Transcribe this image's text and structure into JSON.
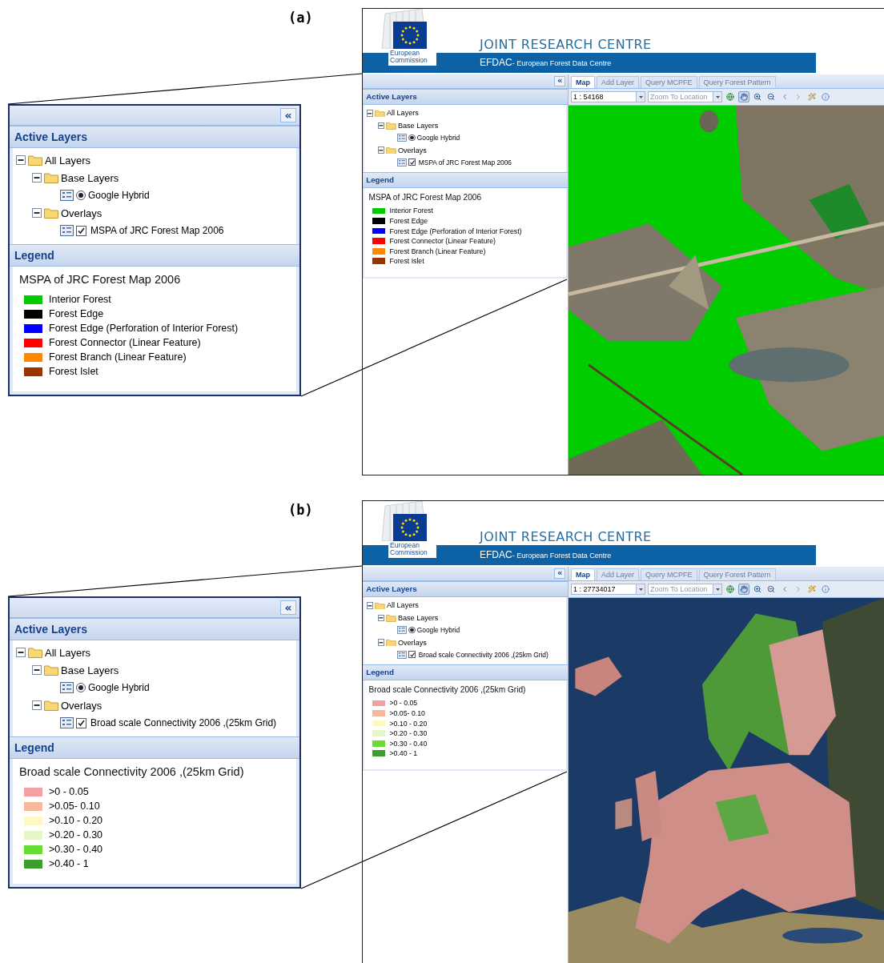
{
  "panels": [
    {
      "label": "(a)",
      "callout": {
        "collapse": "«",
        "layers_title": "Active Layers",
        "tree": [
          {
            "label": "All Layers",
            "kind": "folder",
            "expanded": true,
            "children": [
              {
                "label": "Base Layers",
                "kind": "folder",
                "expanded": true,
                "children": [
                  {
                    "label": "Google Hybrid",
                    "kind": "radio",
                    "selected": true
                  }
                ]
              },
              {
                "label": "Overlays",
                "kind": "folder",
                "expanded": true,
                "children": [
                  {
                    "label": "MSPA of JRC Forest Map 2006",
                    "kind": "checkbox",
                    "checked": true
                  }
                ]
              }
            ]
          }
        ],
        "legend_title": "Legend",
        "legend": {
          "title": "MSPA of JRC Forest Map 2006",
          "items": [
            {
              "label": "Interior Forest",
              "color": "#00cc00"
            },
            {
              "label": "Forest Edge",
              "color": "#000000"
            },
            {
              "label": "Forest Edge (Perforation of Interior Forest)",
              "color": "#0000ff"
            },
            {
              "label": "Forest Connector (Linear Feature)",
              "color": "#ff0000"
            },
            {
              "label": "Forest Branch (Linear Feature)",
              "color": "#ff8800"
            },
            {
              "label": "Forest Islet",
              "color": "#993300"
            }
          ]
        }
      },
      "app": {
        "header": {
          "logo_caption": "European Commission",
          "title": "JOINT RESEARCH CENTRE",
          "subtitle_lead": "EFDAC",
          "subtitle": "- European Forest Data Centre"
        },
        "sidebar": {
          "collapse": "«",
          "layers_title": "Active Layers",
          "tree": [
            {
              "label": "All Layers",
              "kind": "folder",
              "expanded": true,
              "children": [
                {
                  "label": "Base Layers",
                  "kind": "folder",
                  "expanded": true,
                  "children": [
                    {
                      "label": "Google Hybrid",
                      "kind": "radio",
                      "selected": true
                    }
                  ]
                },
                {
                  "label": "Overlays",
                  "kind": "folder",
                  "expanded": true,
                  "children": [
                    {
                      "label": "MSPA of JRC Forest Map 2006",
                      "kind": "checkbox",
                      "checked": true
                    }
                  ]
                }
              ]
            }
          ],
          "legend_title": "Legend",
          "legend": {
            "title": "MSPA of JRC Forest Map 2006",
            "items": [
              {
                "label": "Interior Forest",
                "color": "#00cc00"
              },
              {
                "label": "Forest Edge",
                "color": "#000000"
              },
              {
                "label": "Forest Edge (Perforation of Interior Forest)",
                "color": "#0000ff"
              },
              {
                "label": "Forest Connector (Linear Feature)",
                "color": "#ff0000"
              },
              {
                "label": "Forest Branch (Linear Feature)",
                "color": "#ff8800"
              },
              {
                "label": "Forest Islet",
                "color": "#993300"
              }
            ]
          }
        },
        "tabs": [
          {
            "label": "Map",
            "selected": true
          },
          {
            "label": "Add Layer",
            "selected": false
          },
          {
            "label": "Query MCPFE",
            "selected": false
          },
          {
            "label": "Query Forest Pattern",
            "selected": false
          }
        ],
        "scale": {
          "value": "1 : 54168"
        },
        "location": {
          "placeholder": "Zoom To Location"
        },
        "tools": [
          {
            "kind": "globe",
            "selected": false
          },
          {
            "kind": "pan",
            "selected": true
          },
          {
            "kind": "zoom-in",
            "selected": false
          },
          {
            "kind": "zoom-out",
            "selected": false
          },
          {
            "kind": "back",
            "selected": false
          },
          {
            "kind": "forward",
            "selected": false
          },
          {
            "kind": "identify",
            "selected": false
          },
          {
            "kind": "info",
            "selected": false
          }
        ]
      }
    },
    {
      "label": "(b)",
      "callout": {
        "collapse": "«",
        "layers_title": "Active Layers",
        "tree": [
          {
            "label": "All Layers",
            "kind": "folder",
            "expanded": true,
            "children": [
              {
                "label": "Base Layers",
                "kind": "folder",
                "expanded": true,
                "children": [
                  {
                    "label": "Google Hybrid",
                    "kind": "radio",
                    "selected": true
                  }
                ]
              },
              {
                "label": "Overlays",
                "kind": "folder",
                "expanded": true,
                "children": [
                  {
                    "label": "Broad scale Connectivity 2006 ,(25km Grid)",
                    "kind": "checkbox",
                    "checked": true
                  }
                ]
              }
            ]
          }
        ],
        "legend_title": "Legend",
        "legend": {
          "title": "Broad scale Connectivity 2006 ,(25km Grid)",
          "items": [
            {
              "label": ">0 - 0.05",
              "color": "#f4a0a0"
            },
            {
              "label": ">0.05- 0.10",
              "color": "#f8b89c"
            },
            {
              "label": ">0.10 - 0.20",
              "color": "#fdf8c4"
            },
            {
              "label": ">0.20 - 0.30",
              "color": "#e6f7c6"
            },
            {
              "label": ">0.30 - 0.40",
              "color": "#66dd33"
            },
            {
              "label": ">0.40 - 1",
              "color": "#3c9e2c"
            }
          ]
        }
      },
      "app": {
        "header": {
          "logo_caption": "European Commission",
          "title": "JOINT RESEARCH CENTRE",
          "subtitle_lead": "EFDAC",
          "subtitle": "- European Forest Data Centre"
        },
        "sidebar": {
          "collapse": "«",
          "layers_title": "Active Layers",
          "tree": [
            {
              "label": "All Layers",
              "kind": "folder",
              "expanded": true,
              "children": [
                {
                  "label": "Base Layers",
                  "kind": "folder",
                  "expanded": true,
                  "children": [
                    {
                      "label": "Google Hybrid",
                      "kind": "radio",
                      "selected": true
                    }
                  ]
                },
                {
                  "label": "Overlays",
                  "kind": "folder",
                  "expanded": true,
                  "children": [
                    {
                      "label": "Broad scale Connectivity 2006 ,(25km Grid)",
                      "kind": "checkbox",
                      "checked": true
                    }
                  ]
                }
              ]
            }
          ],
          "legend_title": "Legend",
          "legend": {
            "title": "Broad scale Connectivity 2006 ,(25km Grid)",
            "items": [
              {
                "label": ">0 - 0.05",
                "color": "#f4a0a0"
              },
              {
                "label": ">0.05- 0.10",
                "color": "#f8b89c"
              },
              {
                "label": ">0.10 - 0.20",
                "color": "#fdf8c4"
              },
              {
                "label": ">0.20 - 0.30",
                "color": "#e6f7c6"
              },
              {
                "label": ">0.30 - 0.40",
                "color": "#66dd33"
              },
              {
                "label": ">0.40 - 1",
                "color": "#3c9e2c"
              }
            ]
          }
        },
        "tabs": [
          {
            "label": "Map",
            "selected": true
          },
          {
            "label": "Add Layer",
            "selected": false
          },
          {
            "label": "Query MCPFE",
            "selected": false
          },
          {
            "label": "Query Forest Pattern",
            "selected": false
          }
        ],
        "scale": {
          "value": "1 : 27734017"
        },
        "location": {
          "placeholder": "Zoom To Location"
        },
        "tools": [
          {
            "kind": "globe",
            "selected": false
          },
          {
            "kind": "pan",
            "selected": true
          },
          {
            "kind": "zoom-in",
            "selected": false
          },
          {
            "kind": "zoom-out",
            "selected": false
          },
          {
            "kind": "back",
            "selected": false
          },
          {
            "kind": "forward",
            "selected": false
          },
          {
            "kind": "identify",
            "selected": false
          },
          {
            "kind": "info",
            "selected": false
          }
        ]
      }
    }
  ]
}
